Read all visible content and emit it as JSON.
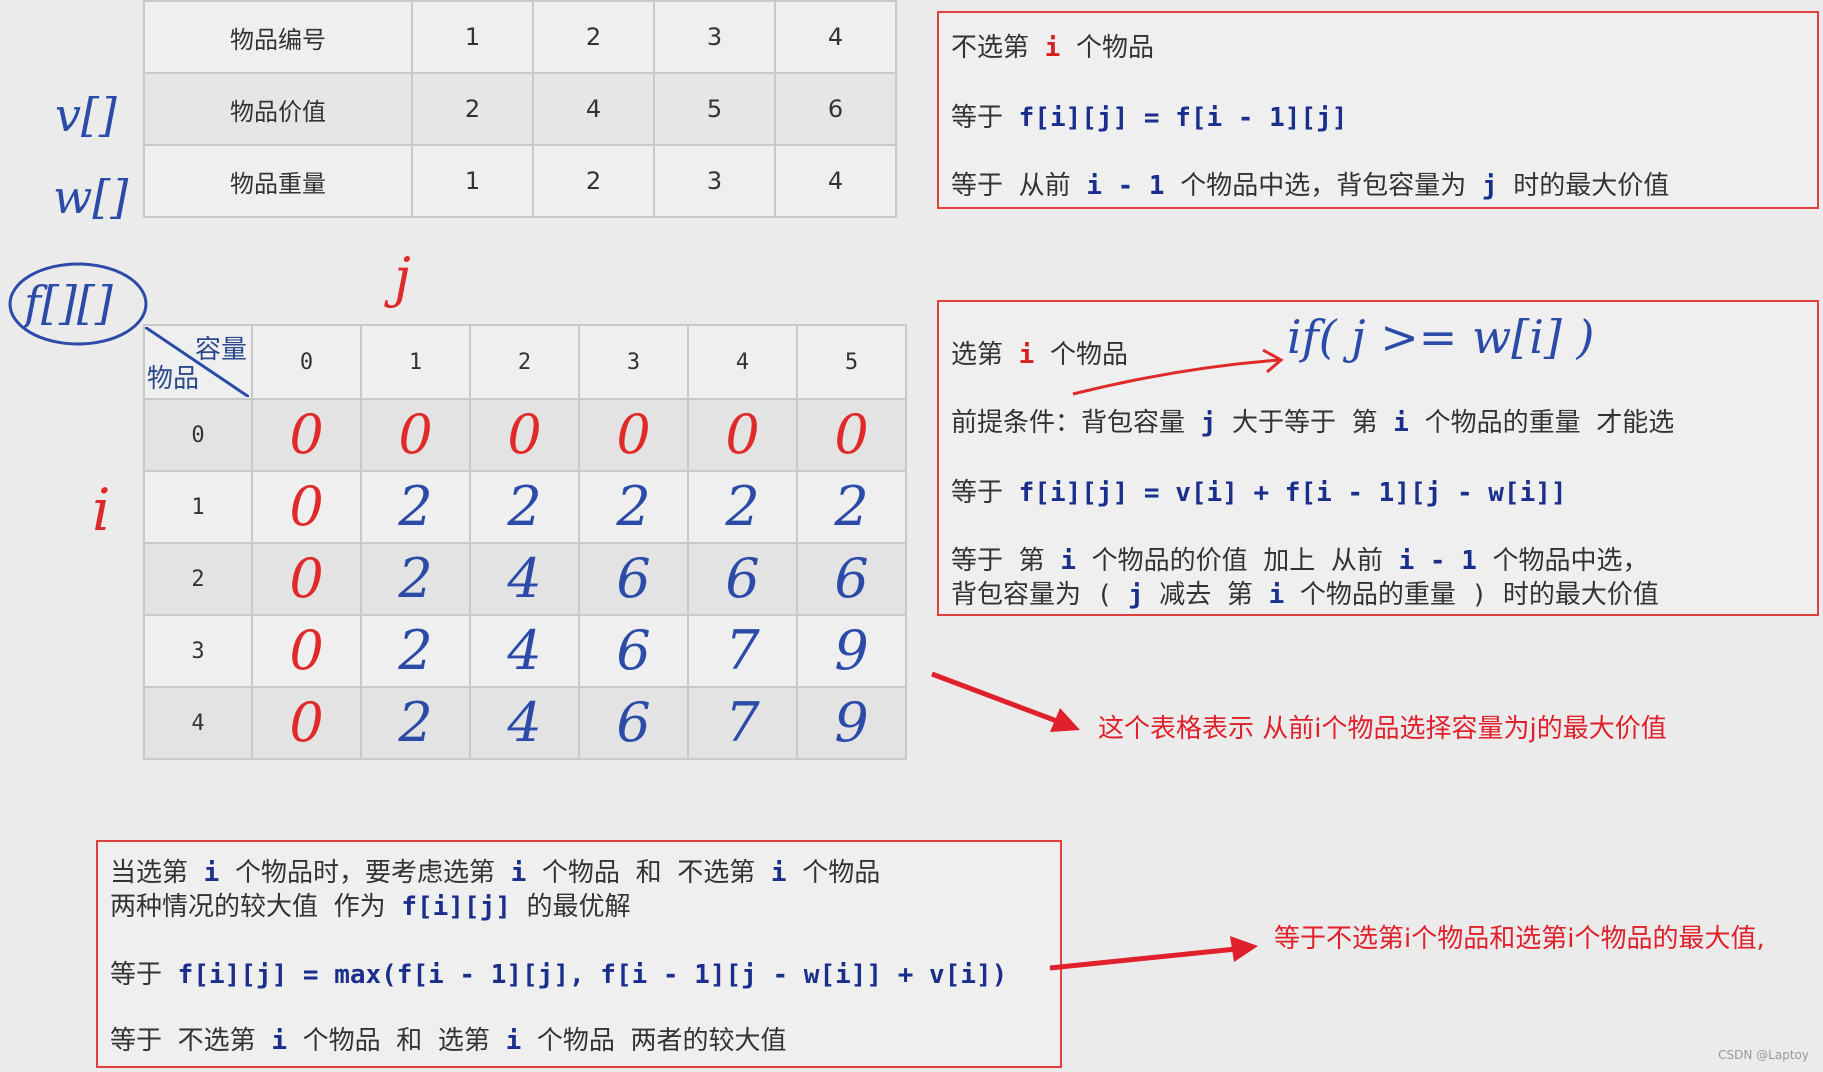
{
  "items_table": {
    "rows": [
      {
        "label": "物品编号",
        "values": [
          "1",
          "2",
          "3",
          "4"
        ]
      },
      {
        "label": "物品价值",
        "values": [
          "2",
          "4",
          "5",
          "6"
        ]
      },
      {
        "label": "物品重量",
        "values": [
          "1",
          "2",
          "3",
          "4"
        ]
      }
    ],
    "annotations": {
      "v": "v[]",
      "w": "w[]"
    }
  },
  "dp_table": {
    "label": "f[][]",
    "col_axis": "j",
    "row_axis": "i",
    "corner_top": "容量",
    "corner_bottom": "物品",
    "columns": [
      "0",
      "1",
      "2",
      "3",
      "4",
      "5"
    ],
    "rows": [
      {
        "label": "0",
        "cells": [
          "0",
          "0",
          "0",
          "0",
          "0",
          "0"
        ]
      },
      {
        "label": "1",
        "cells": [
          "0",
          "2",
          "2",
          "2",
          "2",
          "2"
        ]
      },
      {
        "label": "2",
        "cells": [
          "0",
          "2",
          "4",
          "6",
          "6",
          "6"
        ]
      },
      {
        "label": "3",
        "cells": [
          "0",
          "2",
          "4",
          "6",
          "7",
          "9"
        ]
      },
      {
        "label": "4",
        "cells": [
          "0",
          "2",
          "4",
          "6",
          "7",
          "9"
        ]
      }
    ]
  },
  "box_not_select": {
    "l1a": "不选第 ",
    "l1b": "i",
    "l1c": " 个物品",
    "l2a": "等于 ",
    "l2b": "f[i][j] = f[i - 1][j]",
    "l3a": "等于 从前 ",
    "l3b": "i - 1",
    "l3c": " 个物品中选，背包容量为 ",
    "l3d": "j",
    "l3e": " 时的最大价值"
  },
  "box_select": {
    "l1a": "选第 ",
    "l1b": "i",
    "l1c": " 个物品",
    "hand_condition": "if( j >= w[i] )",
    "l2a": "前提条件：背包容量 ",
    "l2b": "j",
    "l2c": " 大于等于 第 ",
    "l2d": "i",
    "l2e": " 个物品的重量 才能选",
    "l3a": "等于 ",
    "l3b": "f[i][j] = v[i] + f[i - 1][j - w[i]]",
    "l4a": "等于 第 ",
    "l4b": "i",
    "l4c": " 个物品的价值 加上 从前 ",
    "l4d": "i - 1",
    "l4e": " 个物品中选，",
    "l5a": "背包容量为 ( ",
    "l5b": "j",
    "l5c": " 减去 第 ",
    "l5d": "i",
    "l5e": " 个物品的重量 ) 时的最大价值"
  },
  "box_summary": {
    "l1a": "当选第 ",
    "l1b": "i",
    "l1c": " 个物品时，要考虑选第 ",
    "l1d": "i",
    "l1e": " 个物品 和 不选第 ",
    "l1f": "i",
    "l1g": " 个物品",
    "l2a": "两种情况的较大值 作为 ",
    "l2b": "f[i][j]",
    "l2c": " 的最优解",
    "l3a": "等于 ",
    "l3b": "f[i][j] = max(f[i - 1][j], f[i - 1][j - w[i]] + v[i])",
    "l4a": "等于 不选第 ",
    "l4b": "i",
    "l4c": " 个物品 和 选第 ",
    "l4d": "i",
    "l4e": " 个物品 两者的较大值"
  },
  "notes": {
    "table_meaning": "这个表格表示 从前i个物品选择容量为j的最大价值",
    "max_meaning": "等于不选第i个物品和选第i个物品的最大值,"
  },
  "watermark": "CSDN @Laptoy",
  "colors": {
    "box_border": "#e0413f",
    "ink_blue": "#2b4ba8",
    "ink_red": "#e02a2a",
    "arrow": "#e0202a"
  }
}
